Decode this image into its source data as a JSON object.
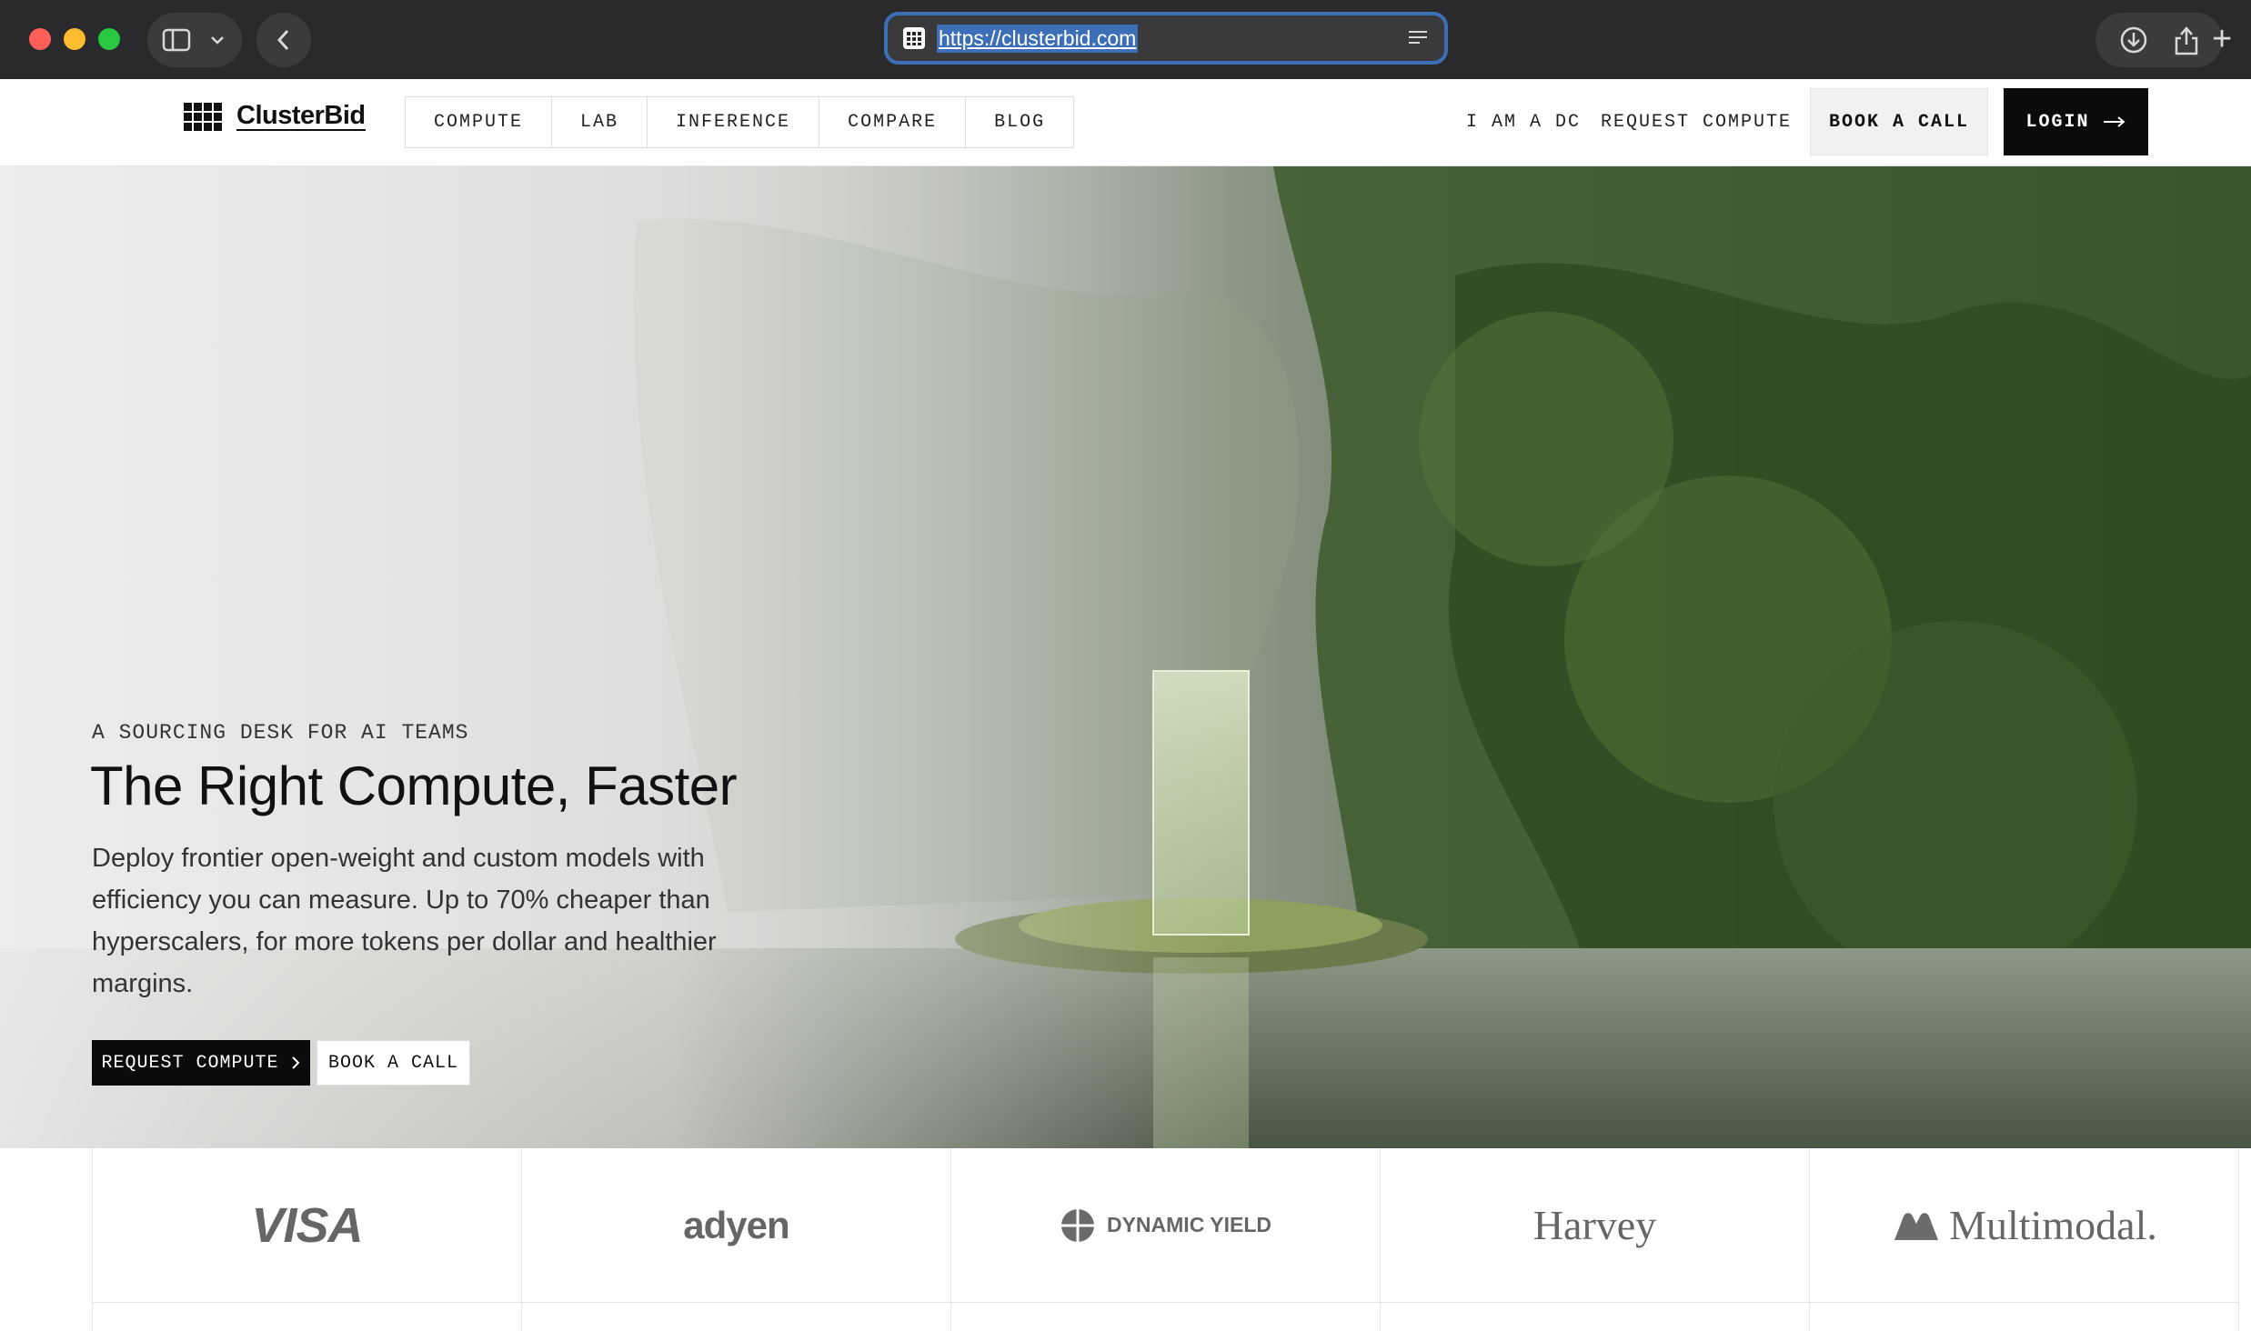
{
  "browser": {
    "url": "https://clusterbid.com"
  },
  "brand": {
    "name": "ClusterBid"
  },
  "nav": {
    "tabs": [
      "COMPUTE",
      "LAB",
      "INFERENCE",
      "COMPARE",
      "BLOG"
    ],
    "i_am_dc": "I AM A DC",
    "request_compute": "REQUEST COMPUTE",
    "book_call": "BOOK A CALL",
    "login": "LOGIN"
  },
  "hero": {
    "eyebrow": "A SOURCING DESK FOR AI TEAMS",
    "title": "The Right Compute, Faster",
    "subtitle": "Deploy frontier open-weight and custom models with efficiency you can measure. Up to 70% cheaper than hyperscalers, for more tokens per dollar and healthier margins.",
    "cta_primary": "REQUEST COMPUTE",
    "cta_secondary": "BOOK A CALL"
  },
  "logos": {
    "visa": "VISA",
    "adyen": "adyen",
    "dynamic_yield": "DYNAMIC YIELD",
    "harvey": "Harvey",
    "multimodal": "Multimodal."
  },
  "colors": {
    "accent": "#0b0b0b",
    "url_highlight": "#3d6fb6"
  }
}
